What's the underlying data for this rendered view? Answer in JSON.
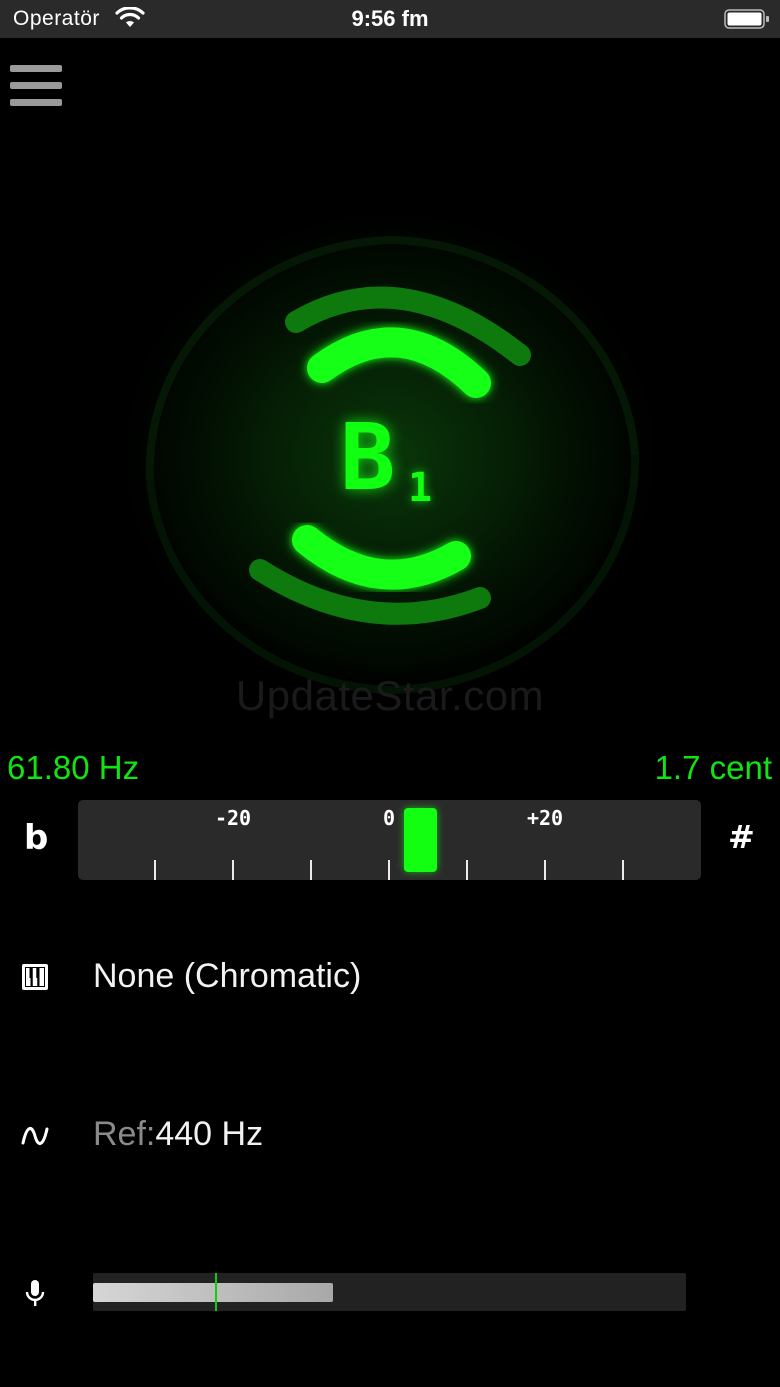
{
  "status_bar": {
    "carrier": "Operatör",
    "time": "9:56 fm"
  },
  "tuner": {
    "note": "B",
    "octave": "1",
    "frequency": "61.80 Hz",
    "cents": "1.7 cent",
    "cents_value": 1.7,
    "flat_symbol": "b",
    "sharp_symbol": "#"
  },
  "meter": {
    "labels": [
      "-20",
      "0",
      "+20"
    ],
    "range": [
      -40,
      40
    ],
    "ticks": [
      -30,
      -20,
      -10,
      0,
      10,
      20,
      30
    ]
  },
  "instrument": {
    "label": "None (Chromatic)"
  },
  "reference": {
    "prefix": "Ref:",
    "value": "440 Hz"
  },
  "input_level": {
    "level": 0.405,
    "peak": 0.205
  },
  "watermark": "UpdateStar.com",
  "colors": {
    "accent": "#11ff11",
    "background": "#000000",
    "panel": "#2a2a2a"
  }
}
